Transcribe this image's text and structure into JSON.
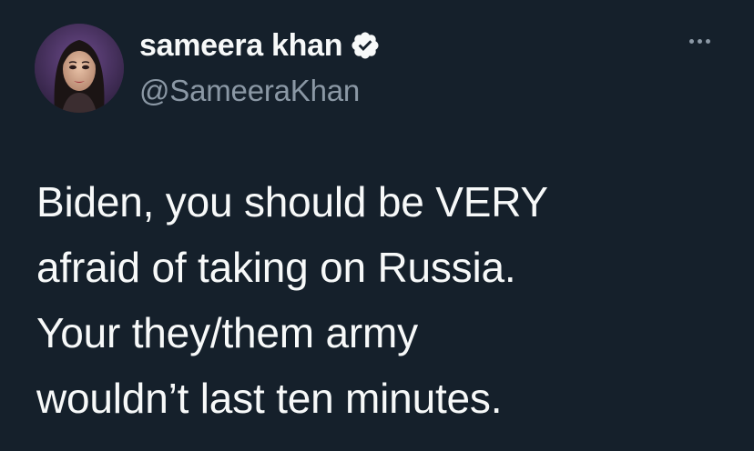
{
  "author": {
    "display_name": "sameera khan",
    "handle": "@SameeraKhan",
    "verified": true
  },
  "tweet": {
    "lines": [
      "Biden, you should be VERY",
      "afraid of taking on Russia.",
      "Your they/them army",
      "wouldn’t last ten minutes."
    ]
  },
  "icons": {
    "verified": "verified-badge-icon",
    "more": "more-options-icon"
  },
  "colors": {
    "background": "#15202b",
    "text": "#f7f9f9",
    "secondary_text": "#8b98a5",
    "verified_badge": "#f7f9f9"
  }
}
